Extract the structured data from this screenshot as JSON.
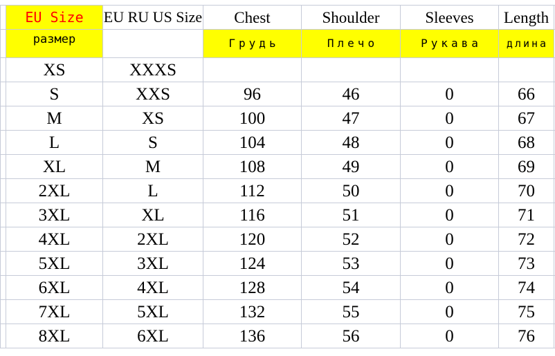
{
  "table": {
    "headers_en": {
      "eu_size": "EU Size",
      "eu_ru_us_size": "EU RU US Size",
      "chest": "Chest",
      "shoulder": "Shoulder",
      "sleeves": "Sleeves",
      "length": "Length"
    },
    "headers_ru": {
      "eu_size": "размер",
      "eu_ru_us_size": "",
      "chest": "Грудь",
      "shoulder": "Плечо",
      "sleeves": "Рукава",
      "length": "длина"
    },
    "colors": {
      "highlight": "#ffff00",
      "eu_size_text": "#ff0000",
      "grid": "#c6cbd8",
      "text": "#000000",
      "background": "#ffffff"
    },
    "columns": [
      "EU Size",
      "EU RU US Size",
      "Chest",
      "Shoulder",
      "Sleeves",
      "Length"
    ],
    "rows": [
      {
        "eu_size": "XS",
        "eu_ru_us_size": "XXXS",
        "chest": "",
        "shoulder": "",
        "sleeves": "",
        "length": ""
      },
      {
        "eu_size": "S",
        "eu_ru_us_size": "XXS",
        "chest": "96",
        "shoulder": "46",
        "sleeves": "0",
        "length": "66"
      },
      {
        "eu_size": "M",
        "eu_ru_us_size": "XS",
        "chest": "100",
        "shoulder": "47",
        "sleeves": "0",
        "length": "67"
      },
      {
        "eu_size": "L",
        "eu_ru_us_size": "S",
        "chest": "104",
        "shoulder": "48",
        "sleeves": "0",
        "length": "68"
      },
      {
        "eu_size": "XL",
        "eu_ru_us_size": "M",
        "chest": "108",
        "shoulder": "49",
        "sleeves": "0",
        "length": "69"
      },
      {
        "eu_size": "2XL",
        "eu_ru_us_size": "L",
        "chest": "112",
        "shoulder": "50",
        "sleeves": "0",
        "length": "70"
      },
      {
        "eu_size": "3XL",
        "eu_ru_us_size": "XL",
        "chest": "116",
        "shoulder": "51",
        "sleeves": "0",
        "length": "71"
      },
      {
        "eu_size": "4XL",
        "eu_ru_us_size": "2XL",
        "chest": "120",
        "shoulder": "52",
        "sleeves": "0",
        "length": "72"
      },
      {
        "eu_size": "5XL",
        "eu_ru_us_size": "3XL",
        "chest": "124",
        "shoulder": "53",
        "sleeves": "0",
        "length": "73"
      },
      {
        "eu_size": "6XL",
        "eu_ru_us_size": "4XL",
        "chest": "128",
        "shoulder": "54",
        "sleeves": "0",
        "length": "74"
      },
      {
        "eu_size": "7XL",
        "eu_ru_us_size": "5XL",
        "chest": "132",
        "shoulder": "55",
        "sleeves": "0",
        "length": "75"
      },
      {
        "eu_size": "8XL",
        "eu_ru_us_size": "6XL",
        "chest": "136",
        "shoulder": "56",
        "sleeves": "0",
        "length": "76"
      }
    ]
  }
}
